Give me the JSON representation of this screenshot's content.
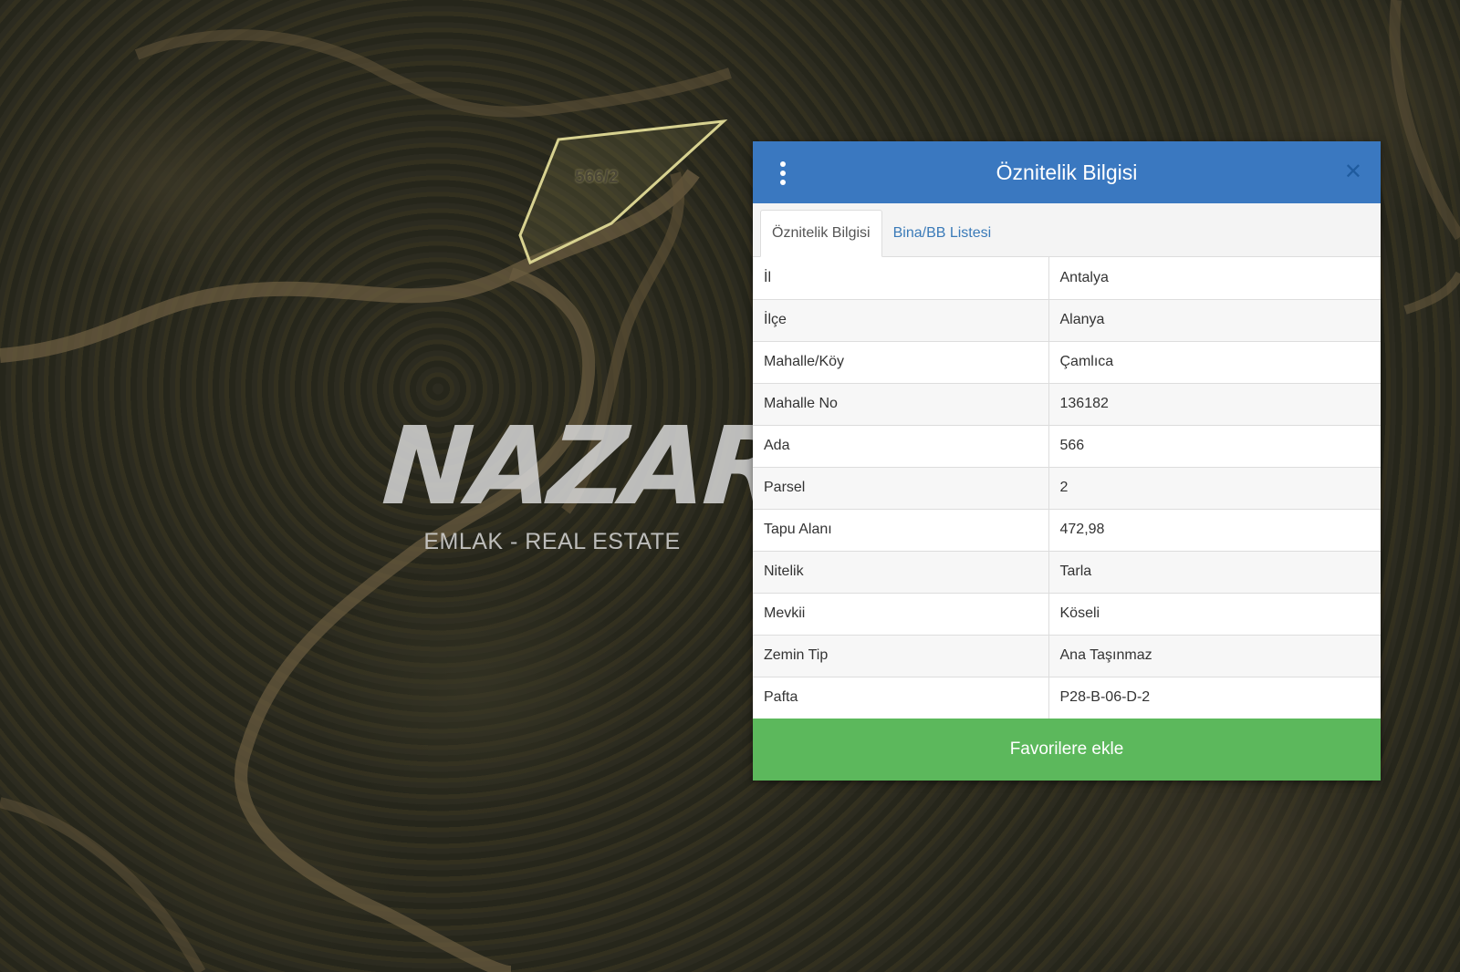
{
  "map": {
    "parcel_label": "566/2"
  },
  "watermark": {
    "logo": "NAZAR",
    "subtitle": "EMLAK - REAL ESTATE"
  },
  "panel": {
    "title": "Öznitelik Bilgisi",
    "menu_icon": "vertical-ellipsis-icon",
    "close_icon": "close-icon",
    "tabs": [
      {
        "label": "Öznitelik Bilgisi",
        "active": true
      },
      {
        "label": "Bina/BB Listesi",
        "active": false
      }
    ],
    "rows": [
      {
        "key": "İl",
        "value": "Antalya"
      },
      {
        "key": "İlçe",
        "value": "Alanya"
      },
      {
        "key": "Mahalle/Köy",
        "value": "Çamlıca"
      },
      {
        "key": "Mahalle No",
        "value": "136182"
      },
      {
        "key": "Ada",
        "value": "566"
      },
      {
        "key": "Parsel",
        "value": "2"
      },
      {
        "key": "Tapu Alanı",
        "value": "472,98"
      },
      {
        "key": "Nitelik",
        "value": "Tarla"
      },
      {
        "key": "Mevkii",
        "value": "Köseli"
      },
      {
        "key": "Zemin Tip",
        "value": "Ana Taşınmaz"
      },
      {
        "key": "Pafta",
        "value": "P28-B-06-D-2"
      }
    ],
    "favorite_button": "Favorilere ekle"
  },
  "colors": {
    "header": "#3a78c0",
    "button": "#5cb85c",
    "parcel_outline": "#d8d290"
  }
}
